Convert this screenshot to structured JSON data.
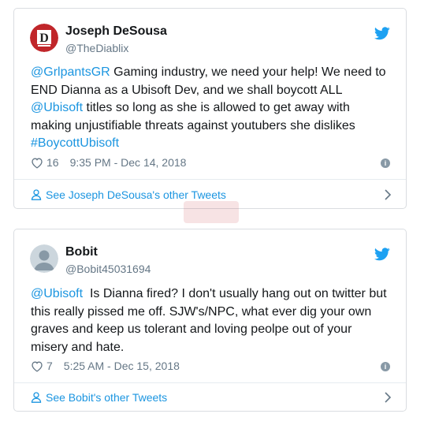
{
  "tweets": [
    {
      "name": "Joseph DeSousa",
      "handle": "@TheDiablix",
      "text_parts": [
        {
          "link": "@GrlpantsGR"
        },
        {
          "plain": " Gaming industry, we need your help! We need to END Dianna as a Ubisoft Dev, and we shall boycott ALL "
        },
        {
          "link": "@Ubisoft"
        },
        {
          "plain": " titles so long as she is allowed to get away with making unjustifiable threats against youtubers she dislikes "
        },
        {
          "link": "#BoycottUbisoft"
        }
      ],
      "likes": "16",
      "timestamp": "9:35 PM - Dec 14, 2018",
      "other_tweets": "See Joseph DeSousa's other Tweets",
      "avatar_icon": "diablix-logo-icon",
      "avatar_color": "#c0262a"
    },
    {
      "name": "Bobit",
      "handle": "@Bobit45031694",
      "text_parts": [
        {
          "link": "@Ubisoft"
        },
        {
          "plain": "  Is Dianna fired? I don't usually hang out on twitter but this really pissed me off. SJW's/NPC, what ever dig your own graves and keep us tolerant and loving peolpe out of your misery and hate."
        }
      ],
      "likes": "7",
      "timestamp": "5:25 AM - Dec 15, 2018",
      "other_tweets": "See Bobit's other Tweets",
      "avatar_icon": "default-avatar-icon",
      "avatar_color": "#ccd6dd"
    }
  ],
  "colors": {
    "link": "#1b95e0",
    "muted": "#657786",
    "twitter_blue": "#1da1f2"
  }
}
